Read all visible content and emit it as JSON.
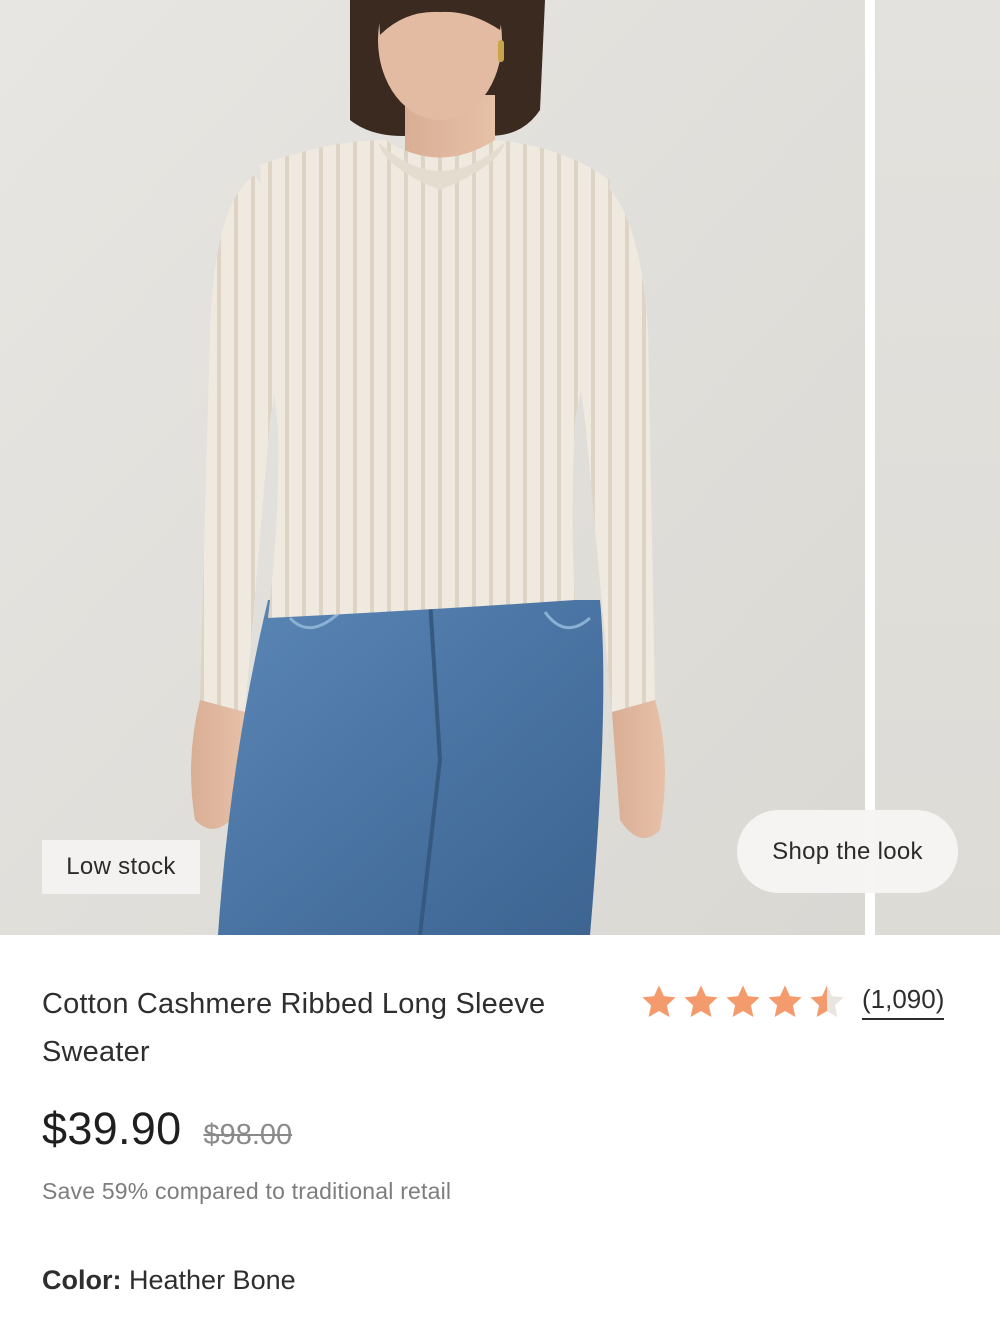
{
  "gallery": {
    "badge": "Low stock",
    "shop_the_look": "Shop the look"
  },
  "product": {
    "title": "Cotton Cashmere Ribbed Long Sleeve Sweater",
    "rating": 4.5,
    "rating_max": 5,
    "star_icons": [
      "star-full-icon",
      "star-full-icon",
      "star-full-icon",
      "star-full-icon",
      "star-half-icon"
    ],
    "review_count": "(1,090)",
    "price": "$39.90",
    "original_price": "$98.00",
    "savings_text": "Save 59% compared to traditional retail",
    "color_label": "Color:",
    "color_value": "Heather Bone"
  },
  "colors": {
    "star": "#f39b6d",
    "star_empty": "#e8e4df",
    "sweater": "#efe9df",
    "jeans": "#4f79a8"
  }
}
